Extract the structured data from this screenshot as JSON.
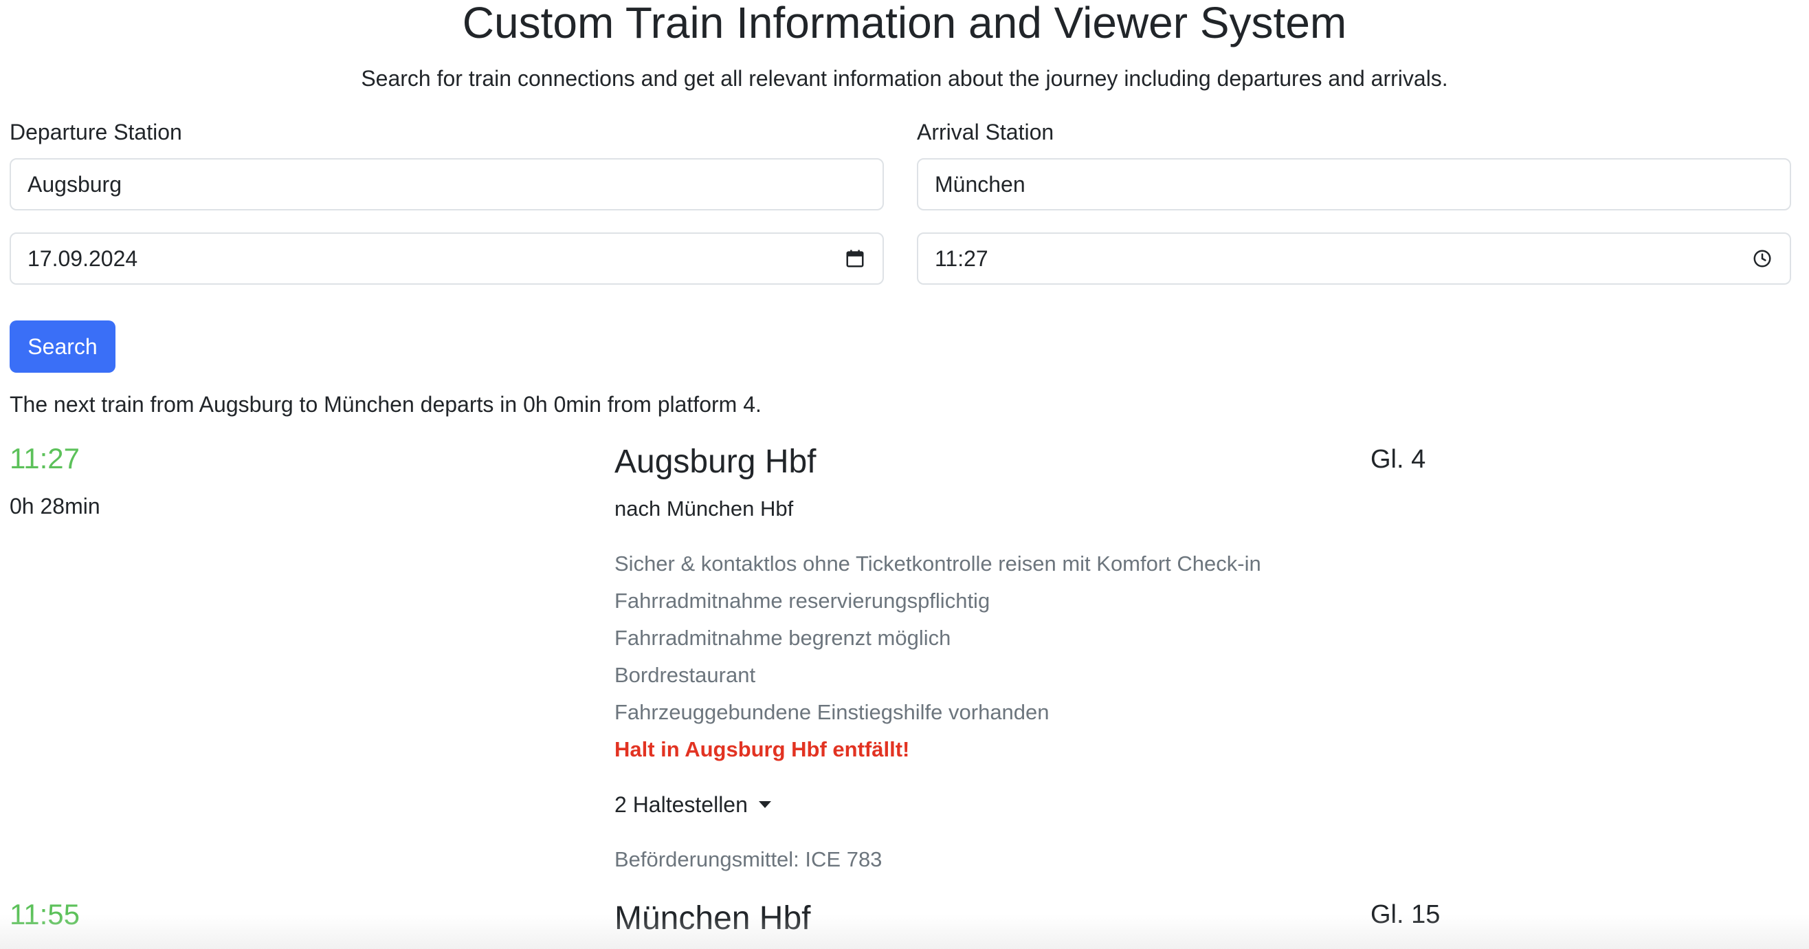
{
  "header": {
    "title": "Custom Train Information and Viewer System",
    "subtitle": "Search for train connections and get all relevant information about the journey including departures and arrivals."
  },
  "form": {
    "departure_label": "Departure Station",
    "departure_value": "Augsburg",
    "arrival_label": "Arrival Station",
    "arrival_value": "München",
    "date_value": "17.09.2024",
    "time_value": "11:27",
    "search_label": "Search"
  },
  "summary": "The next train from Augsburg to München departs in 0h 0min from platform 4.",
  "journey": {
    "departure": {
      "time": "11:27",
      "duration": "0h 28min",
      "station": "Augsburg Hbf",
      "platform": "Gl. 4",
      "direction": "nach München Hbf"
    },
    "notes": [
      "Sicher & kontaktlos ohne Ticketkontrolle reisen mit Komfort Check-in",
      "Fahrradmitnahme reservierungspflichtig",
      "Fahrradmitnahme begrenzt möglich",
      "Bordrestaurant",
      "Fahrzeuggebundene Einstiegshilfe vorhanden"
    ],
    "warning": "Halt in Augsburg Hbf entfällt!",
    "stops_toggle": "2 Haltestellen",
    "transport": "Beförderungsmittel: ICE 783",
    "arrival": {
      "time": "11:55",
      "station": "München Hbf",
      "platform": "Gl. 15"
    }
  },
  "colors": {
    "primary": "#3a6ff7",
    "time_green": "#5cc15a",
    "warning_red": "#e23322",
    "muted": "#6c757d"
  },
  "icons": {
    "date": "calendar-icon",
    "time": "clock-icon",
    "dropdown": "caret-down-icon"
  }
}
